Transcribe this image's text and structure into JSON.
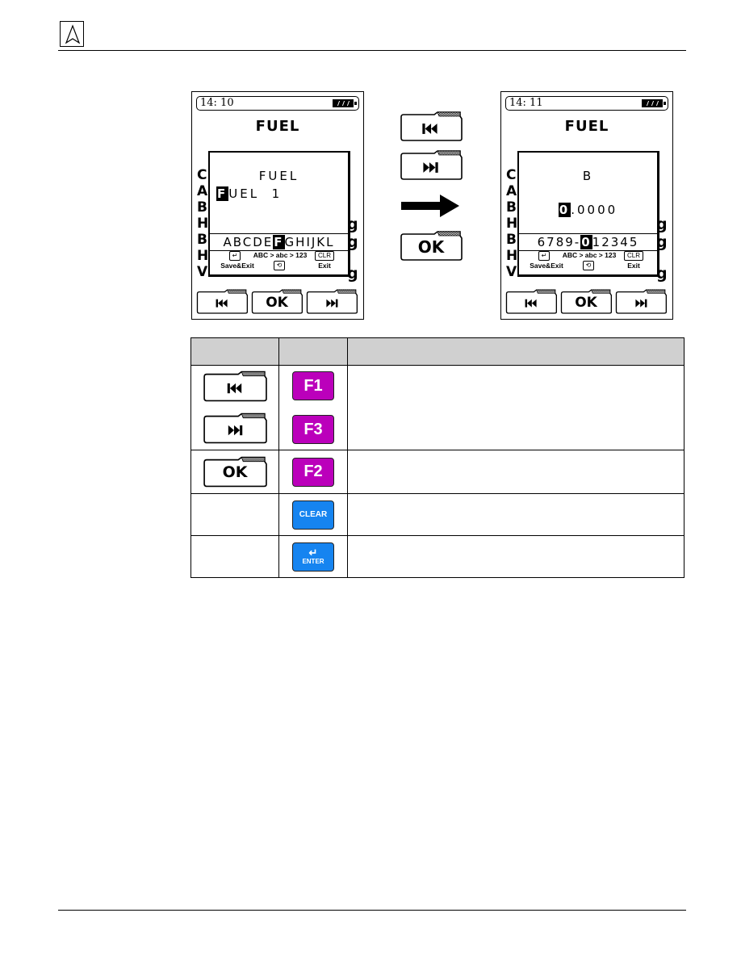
{
  "header": {
    "logo_icon": "navigation-arrow-logo-icon"
  },
  "screens": [
    {
      "clock": "14: 10",
      "battery_icon": "battery-full-icon",
      "title": "FUEL",
      "background_letters": [
        "C",
        "A",
        "B",
        "H",
        "B",
        "H",
        "V"
      ],
      "dialog": {
        "label": "FUEL",
        "value_highlight": "F",
        "value_rest": "UEL  1",
        "charset_before": "ABCDE",
        "charset_selected": "F",
        "charset_after": "GHIJKL",
        "hint_enter_key": "↵",
        "hint_save": "Save&Exit",
        "hint_mode": "ABC > abc > 123",
        "hint_cycle_icon": "cycle-icon",
        "hint_clr_key": "CLR",
        "hint_exit": "Exit"
      },
      "softkeys": [
        {
          "name": "previous",
          "icon": "skip-back-icon",
          "label": ""
        },
        {
          "name": "ok",
          "icon": "",
          "label": "OK"
        },
        {
          "name": "next",
          "icon": "skip-forward-icon",
          "label": ""
        }
      ]
    },
    {
      "clock": "14: 11",
      "battery_icon": "battery-full-icon",
      "title": "FUEL",
      "background_letters": [
        "C",
        "A",
        "B",
        "H",
        "B",
        "H",
        "V"
      ],
      "dialog": {
        "label": "B",
        "value_highlight": "0",
        "value_rest": ".0000",
        "charset_before": "6789-",
        "charset_selected": "0",
        "charset_after": "12345",
        "hint_enter_key": "↵",
        "hint_save": "Save&Exit",
        "hint_mode": "ABC > abc > 123",
        "hint_cycle_icon": "cycle-icon",
        "hint_clr_key": "CLR",
        "hint_exit": "Exit"
      },
      "softkeys": [
        {
          "name": "previous",
          "icon": "skip-back-icon",
          "label": ""
        },
        {
          "name": "ok",
          "icon": "",
          "label": "OK"
        },
        {
          "name": "next",
          "icon": "skip-forward-icon",
          "label": ""
        }
      ]
    }
  ],
  "middle": {
    "keys": [
      {
        "icon": "skip-back-icon",
        "label": ""
      },
      {
        "icon": "skip-forward-icon",
        "label": ""
      },
      {
        "icon": "",
        "label": "OK"
      }
    ],
    "arrow_icon": "arrow-right-icon"
  },
  "table": {
    "headers": [
      "",
      "",
      ""
    ],
    "rows": [
      {
        "softkeys": [
          "skip-back",
          "skip-forward"
        ],
        "hardkeys": [
          "F1",
          "F3"
        ],
        "description": ""
      },
      {
        "softkeys": [
          "OK"
        ],
        "hardkeys": [
          "F2"
        ],
        "description": ""
      },
      {
        "softkeys": [],
        "hardkeys": [
          "CLEAR"
        ],
        "description": ""
      },
      {
        "softkeys": [],
        "hardkeys": [
          "ENTER"
        ],
        "enter_symbol": "↵",
        "description": ""
      }
    ]
  },
  "colors": {
    "function_key": "#bb00bb",
    "action_key": "#1684f0",
    "table_header": "#d0d0d0"
  }
}
